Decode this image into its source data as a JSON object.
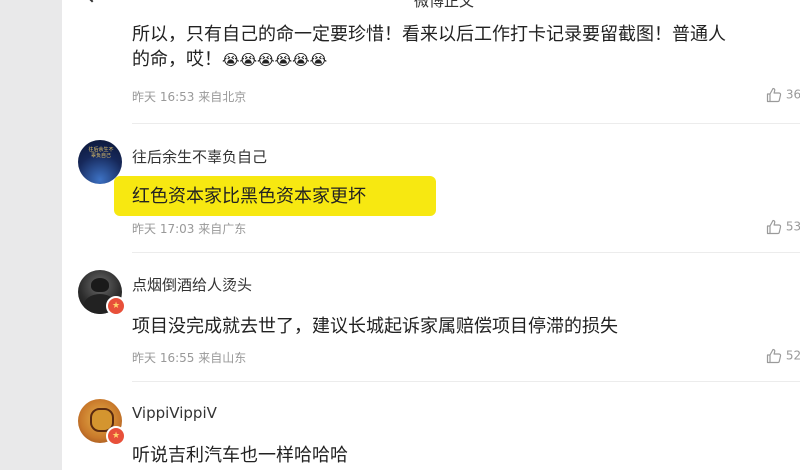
{
  "header": {
    "title": "微博正文"
  },
  "comments": [
    {
      "text_line1": "所以，只有自己的命一定要珍惜！看来以后工作打卡记录要留截图！普通人",
      "text_line2": "的命，哎！",
      "emojis": "😭😭😭😭😭😭",
      "meta": "昨天 16:53 来自北京",
      "likes": "36"
    },
    {
      "username": "往后余生不辜负自己",
      "avatar_text": "往后余生不辜负自己",
      "text": "红色资本家比黑色资本家更坏",
      "meta": "昨天 17:03 来自广东",
      "likes": "53"
    },
    {
      "username": "点烟倒酒给人烫头",
      "text": "项目没完成就去世了，建议长城起诉家属赔偿项目停滞的损失",
      "meta": "昨天 16:55 来自山东",
      "likes": "52"
    },
    {
      "username": "VippiVippiV",
      "text": "听说吉利汽车也一样哈哈哈"
    }
  ],
  "colors": {
    "highlight": "#f7e811",
    "badge": "#e8503a",
    "meta_text": "#999999"
  },
  "icons": {
    "like": "thumbs-up-icon",
    "badge": "vip-badge-icon",
    "back": "back-arrow-icon"
  }
}
